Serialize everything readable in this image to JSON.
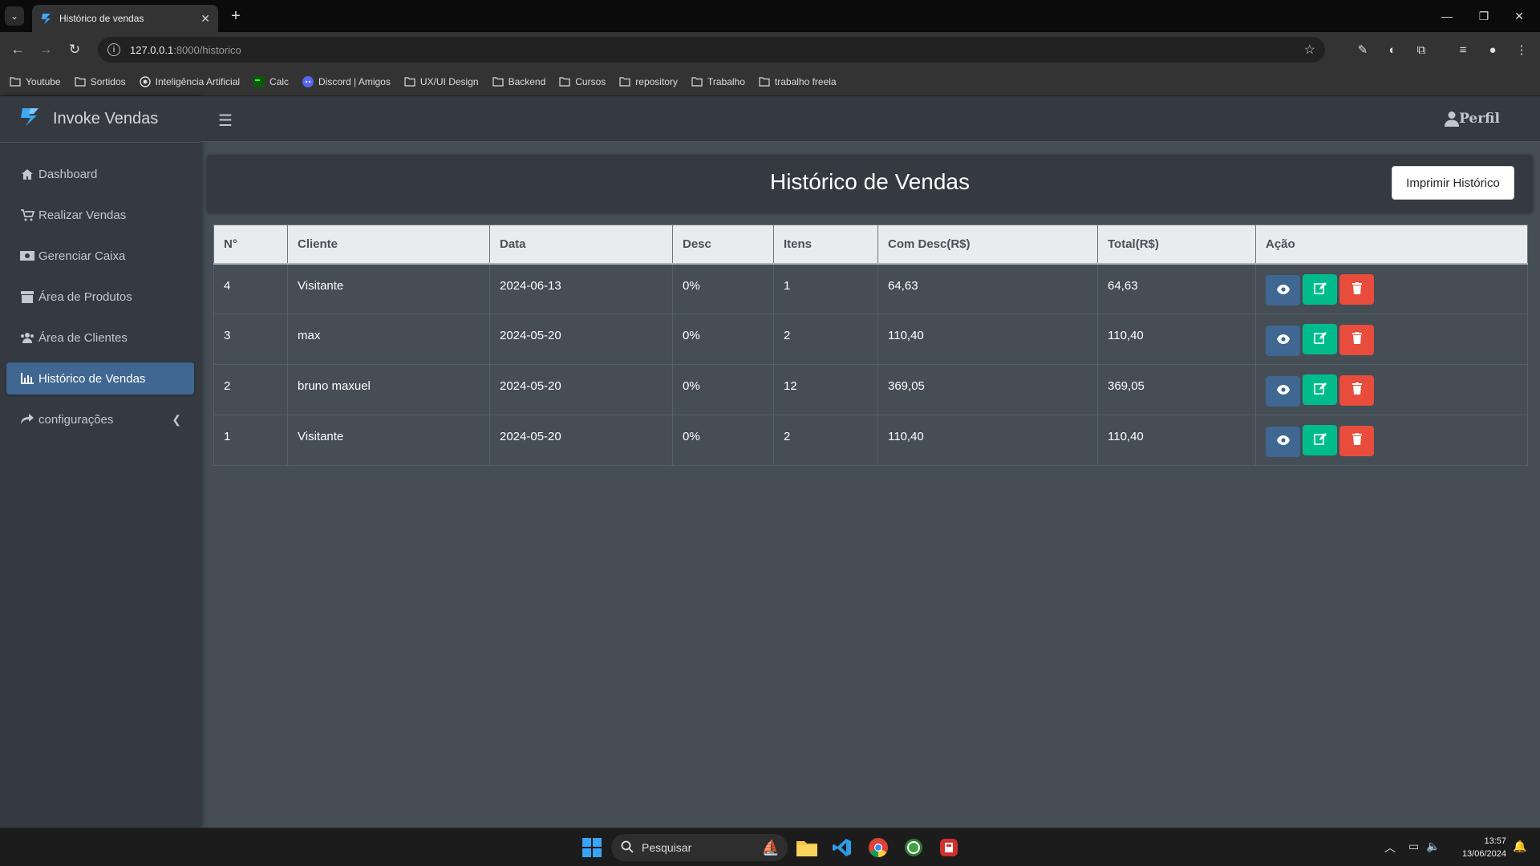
{
  "browser": {
    "tab_title": "Histórico de vendas",
    "url_host": "127.0.0.1",
    "url_path": ":8000/historico",
    "bookmarks": [
      {
        "label": "Youtube",
        "icon": "folder-icon"
      },
      {
        "label": "Sortidos",
        "icon": "folder-icon"
      },
      {
        "label": "Inteligência Artificial",
        "icon": "openai-icon"
      },
      {
        "label": "Calc",
        "icon": "terminal-icon"
      },
      {
        "label": "Discord | Amigos",
        "icon": "discord-icon"
      },
      {
        "label": "UX/UI Design",
        "icon": "folder-icon"
      },
      {
        "label": "Backend",
        "icon": "folder-icon"
      },
      {
        "label": "Cursos",
        "icon": "folder-icon"
      },
      {
        "label": "repository",
        "icon": "folder-icon"
      },
      {
        "label": "Trabalho",
        "icon": "folder-icon"
      },
      {
        "label": "trabalho freela",
        "icon": "folder-icon"
      }
    ]
  },
  "app": {
    "brand": "Invoke Vendas",
    "profile_label": "Perfil",
    "menu": [
      {
        "label": "Dashboard",
        "icon": "home-icon",
        "active": false
      },
      {
        "label": "Realizar Vendas",
        "icon": "cart-icon",
        "active": false
      },
      {
        "label": "Gerenciar Caixa",
        "icon": "money-icon",
        "active": false
      },
      {
        "label": "Área de Produtos",
        "icon": "box-icon",
        "active": false
      },
      {
        "label": "Área de Clientes",
        "icon": "users-icon",
        "active": false
      },
      {
        "label": "Histórico de Vendas",
        "icon": "chart-icon",
        "active": true
      },
      {
        "label": "configurações",
        "icon": "share-icon",
        "active": false
      }
    ]
  },
  "page": {
    "title": "Histórico de Vendas",
    "print_button": "Imprimir Histórico"
  },
  "table": {
    "headers": [
      "N°",
      "Cliente",
      "Data",
      "Desc",
      "Itens",
      "Com Desc(R$)",
      "Total(R$)",
      "Ação"
    ],
    "rows": [
      {
        "n": "4",
        "cliente": "Visitante",
        "data": "2024-06-13",
        "desc": "0%",
        "itens": "1",
        "com_desc": "64,63",
        "total": "64,63"
      },
      {
        "n": "3",
        "cliente": "max",
        "data": "2024-05-20",
        "desc": "0%",
        "itens": "2",
        "com_desc": "110,40",
        "total": "110,40"
      },
      {
        "n": "2",
        "cliente": "bruno maxuel",
        "data": "2024-05-20",
        "desc": "0%",
        "itens": "12",
        "com_desc": "369,05",
        "total": "369,05"
      },
      {
        "n": "1",
        "cliente": "Visitante",
        "data": "2024-05-20",
        "desc": "0%",
        "itens": "2",
        "com_desc": "110,40",
        "total": "110,40"
      }
    ]
  },
  "taskbar": {
    "search_placeholder": "Pesquisar",
    "time": "13:57",
    "date": "13/06/2024"
  },
  "colors": {
    "primary": "#3f6791",
    "success": "#00bc8c",
    "danger": "#e74c3c",
    "sidebar_bg": "#343a40",
    "content_bg": "#454d55"
  }
}
